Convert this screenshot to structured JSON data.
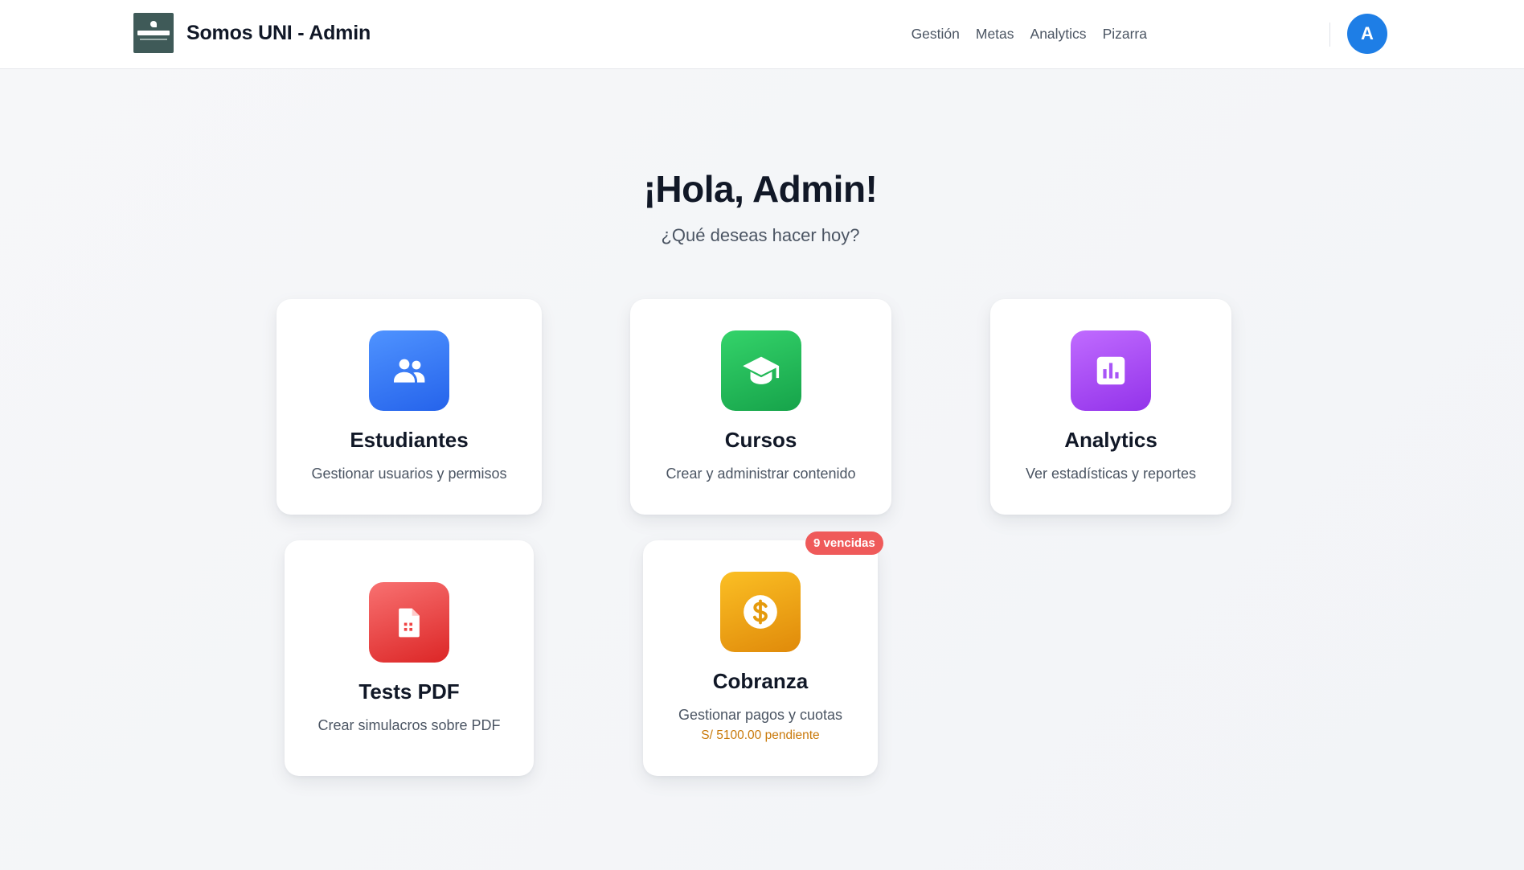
{
  "app": {
    "title": "Somos UNI - Admin",
    "logo_icon": "somos-uni-logo"
  },
  "nav": {
    "items": [
      {
        "label": "Gestión"
      },
      {
        "label": "Metas"
      },
      {
        "label": "Analytics"
      },
      {
        "label": "Pizarra"
      }
    ],
    "avatar_initial": "A",
    "avatar_color": "#1e7ee6"
  },
  "greeting": {
    "title": "¡Hola, Admin!",
    "subtitle": "¿Qué deseas hacer hoy?"
  },
  "cards": [
    {
      "title": "Estudiantes",
      "description": "Gestionar usuarios y permisos",
      "icon": "users-icon",
      "color": "#2563eb"
    },
    {
      "title": "Cursos",
      "description": "Crear y administrar contenido",
      "icon": "graduation-cap-icon",
      "color": "#16a34a"
    },
    {
      "title": "Analytics",
      "description": "Ver estadísticas y reportes",
      "icon": "bar-chart-icon",
      "color": "#9333ea"
    },
    {
      "title": "Tests PDF",
      "description": "Crear simulacros sobre PDF",
      "icon": "pdf-file-icon",
      "color": "#dc2626"
    },
    {
      "title": "Cobranza",
      "description": "Gestionar pagos y cuotas",
      "icon": "dollar-coin-icon",
      "color": "#e08a0a",
      "badge": "9 vencidas",
      "extra": "S/ 5100.00 pendiente"
    }
  ]
}
